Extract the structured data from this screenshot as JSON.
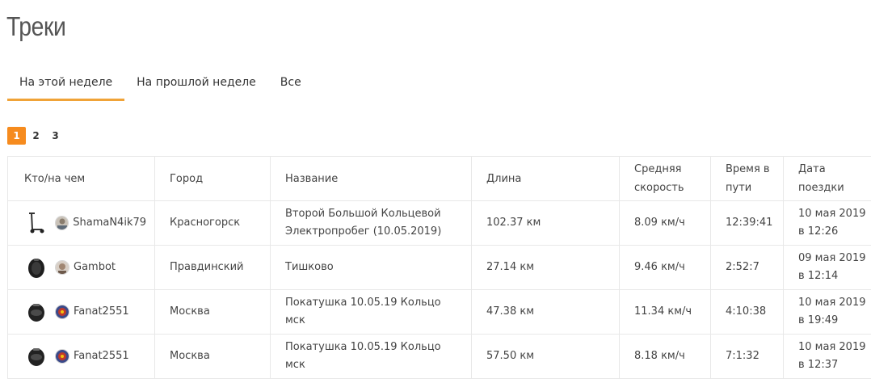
{
  "page": {
    "title": "Треки"
  },
  "tabs": [
    {
      "label": "На этой неделе",
      "active": true
    },
    {
      "label": "На прошлой неделе",
      "active": false
    },
    {
      "label": "Все",
      "active": false
    }
  ],
  "pagination": {
    "pages": [
      "1",
      "2",
      "3"
    ],
    "current": "1"
  },
  "table": {
    "headers": [
      "Кто/на чем",
      "Город",
      "Название",
      "Длина",
      "Средняя скорость",
      "Время в пути",
      "Дата поездки"
    ],
    "rows": [
      {
        "vehicle": "scooter-icon",
        "user": "ShamaN4ik79",
        "city": "Красногорск",
        "name": "Второй Большой Кольцевой Электропробег (10.05.2019)",
        "length": "102.37 км",
        "speed": "8.09 км/ч",
        "duration": "12:39:41",
        "date": "10 мая 2019 в 12:26"
      },
      {
        "vehicle": "monowheel-icon",
        "user": "Gambot",
        "city": "Правдинский",
        "name": "Тишково",
        "length": "27.14 км",
        "speed": "9.46 км/ч",
        "duration": "2:52:7",
        "date": "09 мая 2019 в 12:14"
      },
      {
        "vehicle": "monowheel-icon",
        "user": "Fanat2551",
        "city": "Москва",
        "name": "Покатушка 10.05.19 Кольцо мск",
        "length": "47.38 км",
        "speed": "11.34 км/ч",
        "duration": "4:10:38",
        "date": "10 мая 2019 в 19:49"
      },
      {
        "vehicle": "monowheel-icon",
        "user": "Fanat2551",
        "city": "Москва",
        "name": "Покатушка 10.05.19 Кольцо мск",
        "length": "57.50 км",
        "speed": "8.18 км/ч",
        "duration": "7:1:32",
        "date": "10 мая 2019 в 12:37"
      }
    ]
  },
  "colors": {
    "accent": "#f0a338",
    "page_active": "#f68b1e",
    "border": "#e8e8e8"
  }
}
